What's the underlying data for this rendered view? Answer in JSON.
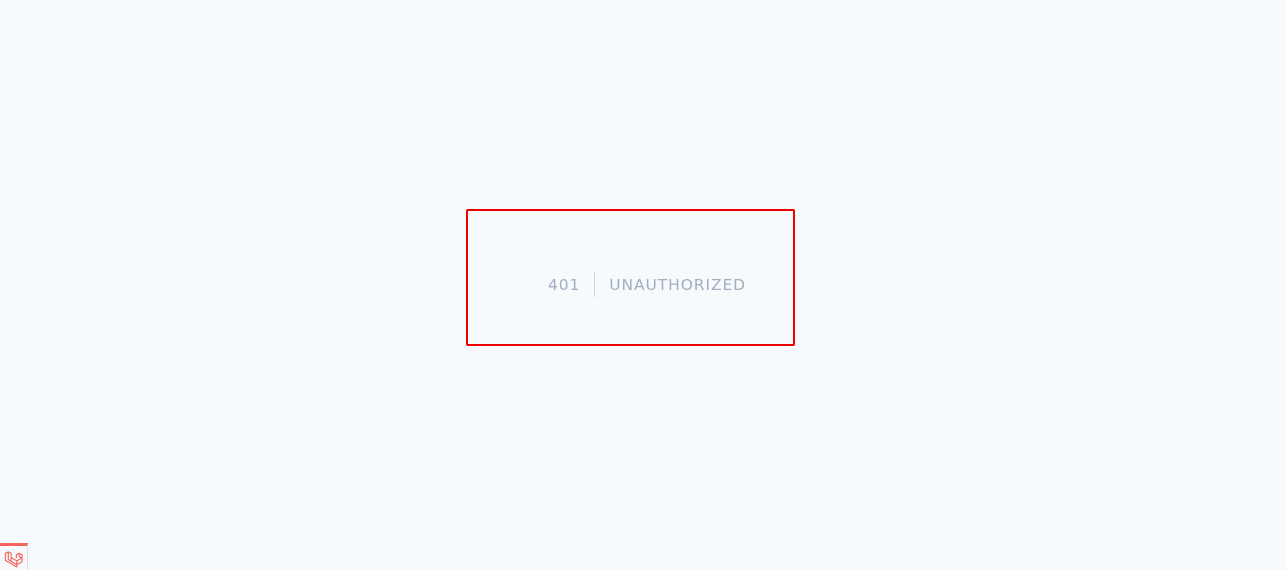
{
  "error": {
    "code": "401",
    "message": "UNAUTHORIZED"
  },
  "colors": {
    "background": "#f7fafc",
    "text": "#a0aec0",
    "divider": "#cbd5e0",
    "highlight": "#ee0000",
    "debugbar_accent": "#f4645f"
  },
  "icons": {
    "debugbar": "laravel-logo-icon"
  }
}
